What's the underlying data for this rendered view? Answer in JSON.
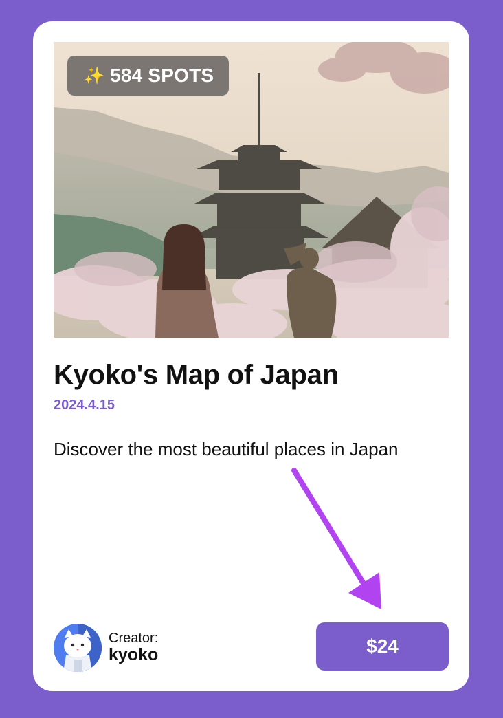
{
  "card": {
    "badge": {
      "icon": "sparkles-icon",
      "glyph": "✨",
      "label": "584 SPOTS"
    },
    "title": "Kyoko's Map of Japan",
    "date": "2024.4.15",
    "description": "Discover the most beautiful places in Japan",
    "creator": {
      "label": "Creator:",
      "name": "kyoko"
    },
    "price_label": "$24"
  },
  "colors": {
    "background": "#7b5ecb",
    "accent": "#7b5ecb",
    "annotation_arrow": "#b144f0"
  }
}
